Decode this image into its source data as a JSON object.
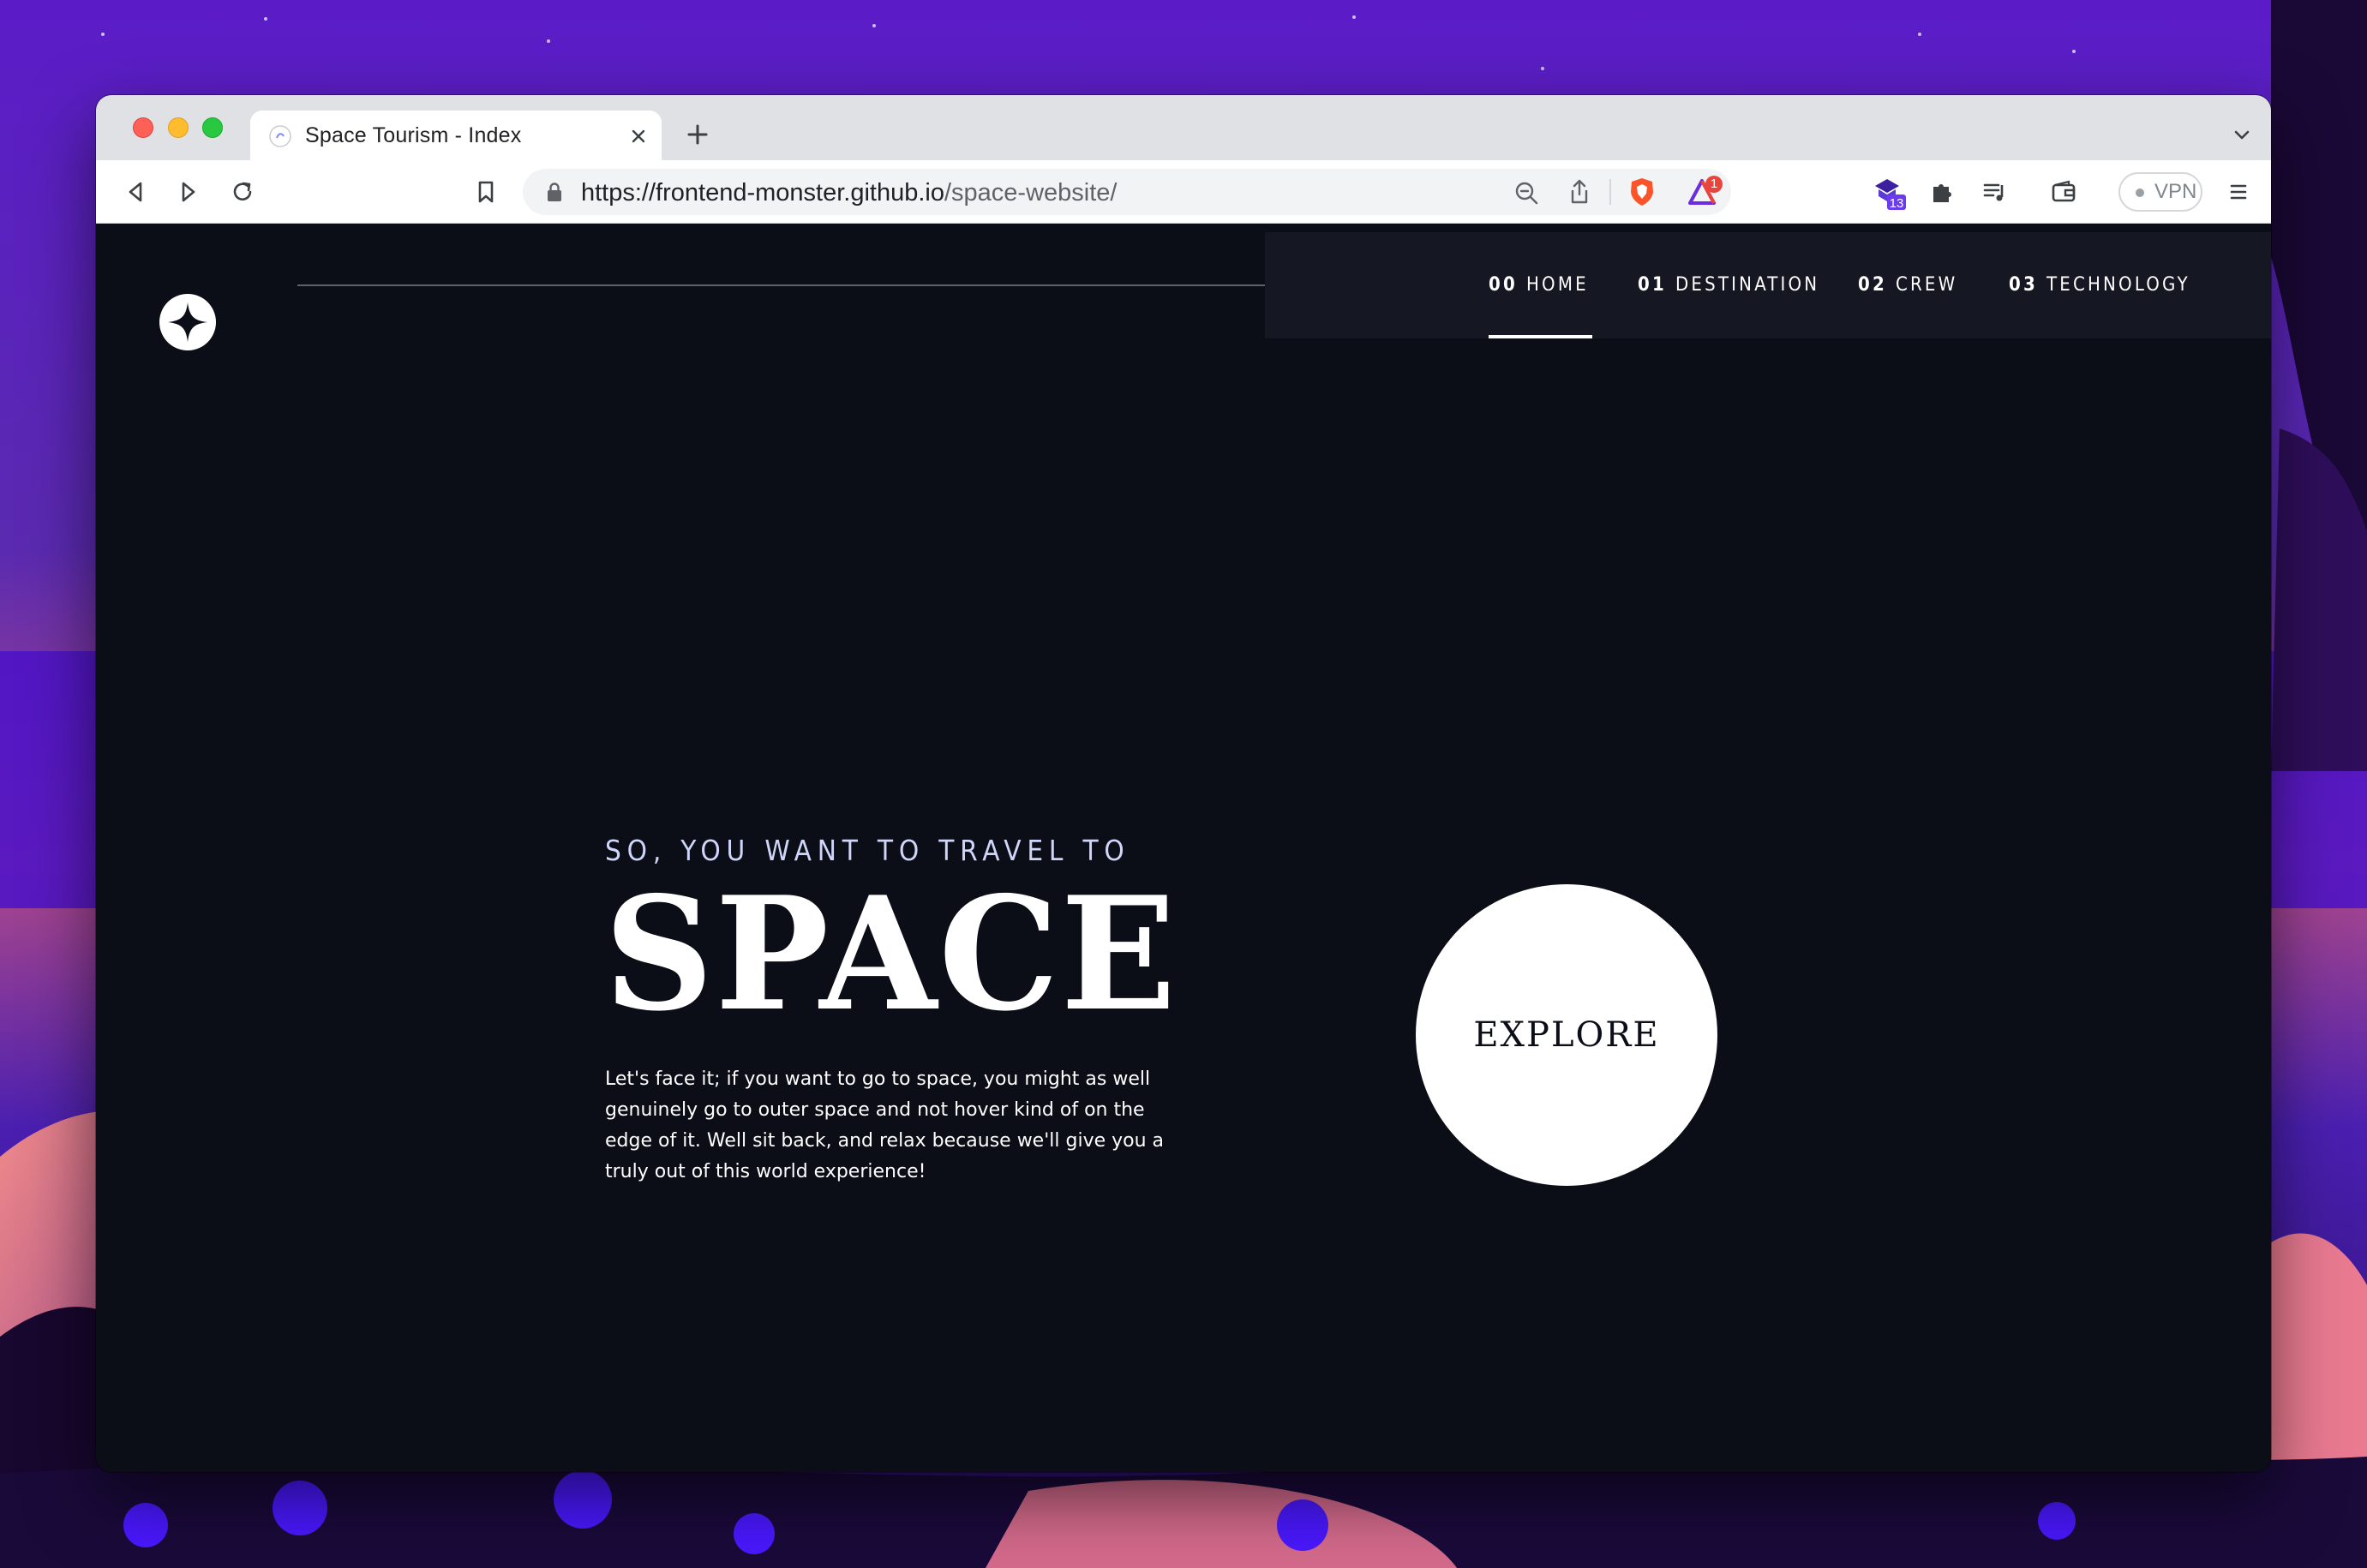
{
  "browser": {
    "tab_title": "Space Tourism - Index",
    "url_host": "https://frontend-monster.github.io",
    "url_path": "/space-website/",
    "vpn_label": "VPN",
    "notification_count": "1",
    "extension_count": "13"
  },
  "site": {
    "nav": [
      {
        "num": "00",
        "label": "HOME",
        "active": true
      },
      {
        "num": "01",
        "label": "DESTINATION"
      },
      {
        "num": "02",
        "label": "CREW"
      },
      {
        "num": "03",
        "label": "TECHNOLOGY"
      }
    ],
    "hero": {
      "eyebrow": "SO, YOU WANT TO TRAVEL TO",
      "title": "SPACE",
      "body": "Let's face it; if you want to go to space, you might as well genuinely go to outer space and not hover kind of on the edge of it. Well sit back, and relax because we'll give you a truly out of this world experience!"
    },
    "cta_label": "EXPLORE"
  },
  "colors": {
    "page_bg": "#0b0d17",
    "nav_bg": "#151823",
    "accent_text": "#d0d6f9",
    "wallpaper_top": "#5a1fc4"
  }
}
